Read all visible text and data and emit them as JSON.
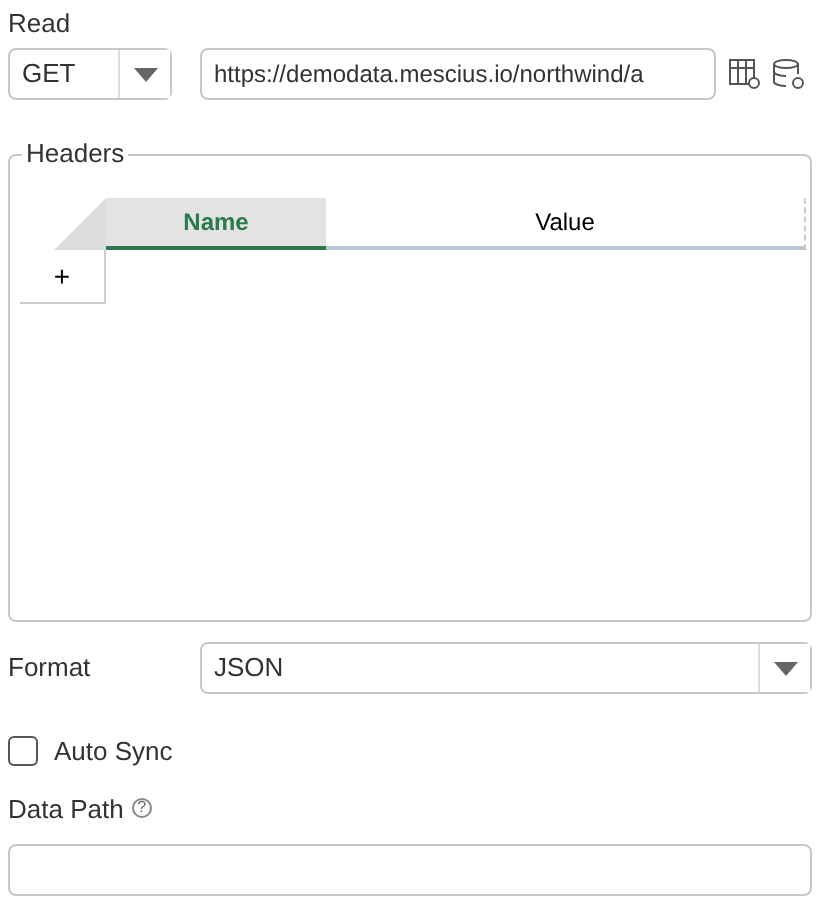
{
  "read": {
    "label": "Read",
    "method": "GET",
    "url": "https://demodata.mescius.io/northwind/a"
  },
  "headers": {
    "legend": "Headers",
    "columns": [
      {
        "label": "Name",
        "selected": true
      },
      {
        "label": "Value",
        "selected": false
      }
    ],
    "add_row": "+"
  },
  "format": {
    "label": "Format",
    "value": "JSON"
  },
  "auto_sync": {
    "label": "Auto Sync",
    "checked": false
  },
  "data_path": {
    "label": "Data Path",
    "help": "?"
  }
}
